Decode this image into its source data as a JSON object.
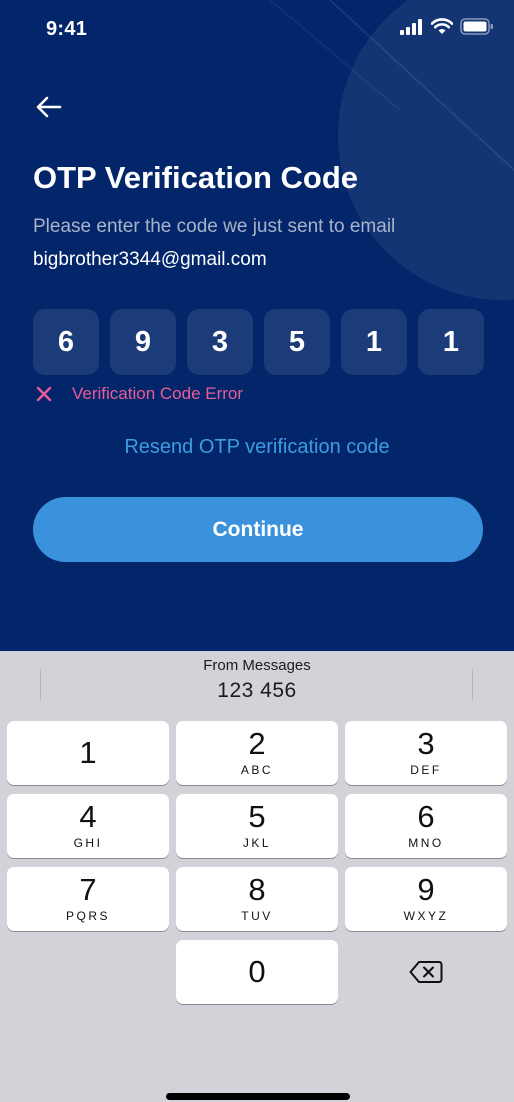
{
  "status_bar": {
    "time": "9:41"
  },
  "header": {
    "title": "OTP Verification Code",
    "subtitle": "Please enter the code we just sent to email",
    "email": "bigbrother3344@gmail.com"
  },
  "otp": {
    "digits": [
      "6",
      "9",
      "3",
      "5",
      "1",
      "1"
    ],
    "error": "Verification Code Error"
  },
  "resend_label": "Resend OTP verification code",
  "continue_label": "Continue",
  "keyboard": {
    "suggestion_label": "From Messages",
    "suggestion_code": "123 456",
    "keys": [
      {
        "num": "1",
        "letters": ""
      },
      {
        "num": "2",
        "letters": "ABC"
      },
      {
        "num": "3",
        "letters": "DEF"
      },
      {
        "num": "4",
        "letters": "GHI"
      },
      {
        "num": "5",
        "letters": "JKL"
      },
      {
        "num": "6",
        "letters": "MNO"
      },
      {
        "num": "7",
        "letters": "PQRS"
      },
      {
        "num": "8",
        "letters": "TUV"
      },
      {
        "num": "9",
        "letters": "WXYZ"
      },
      {
        "num": "0",
        "letters": ""
      }
    ]
  },
  "colors": {
    "background": "#03266a",
    "accent": "#3a92dc",
    "link": "#3d9be0",
    "error": "#e85d96"
  },
  "icons": {
    "back": "arrow-left-icon",
    "error": "close-icon",
    "delete": "backspace-icon",
    "signal": "signal-icon",
    "wifi": "wifi-icon",
    "battery": "battery-icon"
  }
}
